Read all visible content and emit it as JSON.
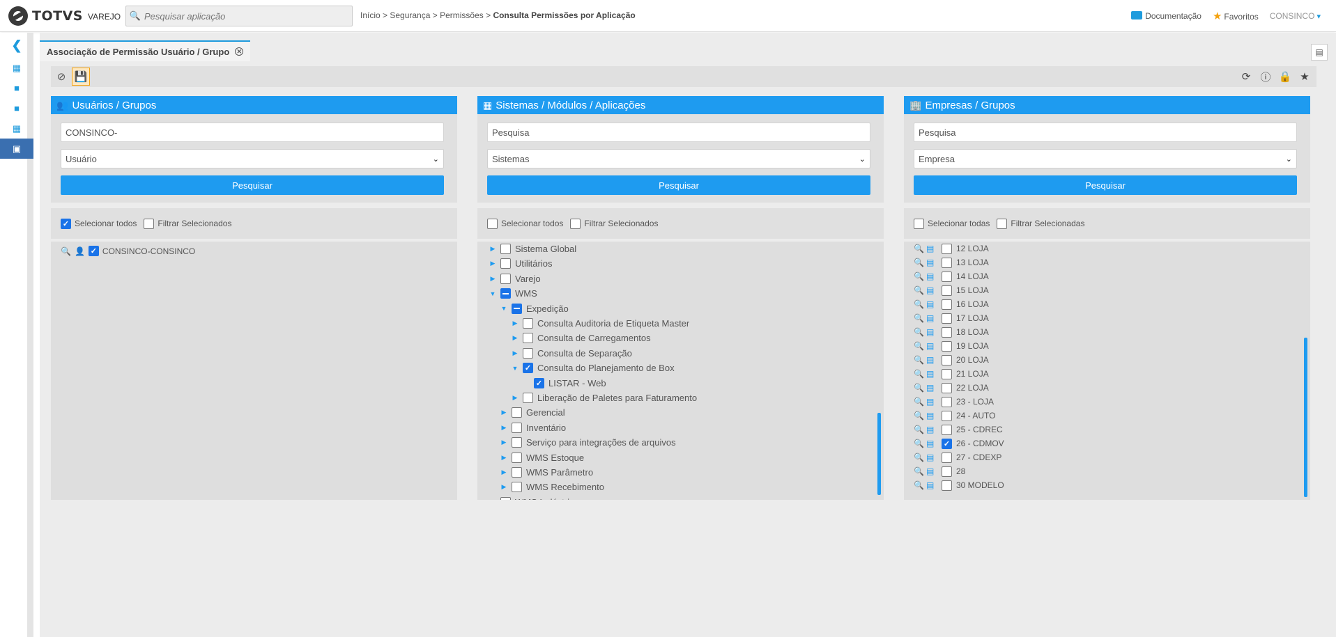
{
  "header": {
    "logo_main": "TOTVS",
    "logo_sub": "VAREJO",
    "search_placeholder": "Pesquisar aplicação",
    "breadcrumb_path": "Início > Segurança > Permissões > ",
    "breadcrumb_current": "Consulta Permissões por Aplicação",
    "documentation": "Documentação",
    "favorites": "Favoritos",
    "user": "CONSINCO"
  },
  "tab": {
    "title": "Associação de Permissão Usuário / Grupo"
  },
  "panels": {
    "users": {
      "title": "Usuários / Grupos",
      "input_value": "CONSINCO-",
      "select_value": "Usuário",
      "button": "Pesquisar",
      "select_all": "Selecionar todos",
      "filter_selected": "Filtrar Selecionados",
      "select_all_checked": true,
      "items": [
        {
          "label": "CONSINCO-CONSINCO",
          "checked": true
        }
      ]
    },
    "systems": {
      "title": "Sistemas / Módulos / Aplicações",
      "input_placeholder": "Pesquisa",
      "select_value": "Sistemas",
      "button": "Pesquisar",
      "select_all": "Selecionar todos",
      "filter_selected": "Filtrar Selecionados",
      "tree": [
        {
          "label": "Sistema Global",
          "level": 0,
          "arrow": "right",
          "state": "off"
        },
        {
          "label": "Utilitários",
          "level": 0,
          "arrow": "right",
          "state": "off"
        },
        {
          "label": "Varejo",
          "level": 0,
          "arrow": "right",
          "state": "off"
        },
        {
          "label": "WMS",
          "level": 0,
          "arrow": "down",
          "state": "part"
        },
        {
          "label": "Expedição",
          "level": 1,
          "arrow": "down",
          "state": "part"
        },
        {
          "label": "Consulta Auditoria de Etiqueta Master",
          "level": 2,
          "arrow": "right",
          "state": "off"
        },
        {
          "label": "Consulta de Carregamentos",
          "level": 2,
          "arrow": "right",
          "state": "off"
        },
        {
          "label": "Consulta de Separação",
          "level": 2,
          "arrow": "right",
          "state": "off"
        },
        {
          "label": "Consulta do Planejamento de Box",
          "level": 2,
          "arrow": "down",
          "state": "on"
        },
        {
          "label": "LISTAR - Web",
          "level": 3,
          "arrow": "none",
          "state": "on"
        },
        {
          "label": "Liberação de Paletes para Faturamento",
          "level": 2,
          "arrow": "right",
          "state": "off"
        },
        {
          "label": "Gerencial",
          "level": 1,
          "arrow": "right",
          "state": "off"
        },
        {
          "label": "Inventário",
          "level": 1,
          "arrow": "right",
          "state": "off"
        },
        {
          "label": "Serviço para integrações de arquivos",
          "level": 1,
          "arrow": "right",
          "state": "off"
        },
        {
          "label": "WMS Estoque",
          "level": 1,
          "arrow": "right",
          "state": "off"
        },
        {
          "label": "WMS Parâmetro",
          "level": 1,
          "arrow": "right",
          "state": "off"
        },
        {
          "label": "WMS Recebimento",
          "level": 1,
          "arrow": "right",
          "state": "off"
        },
        {
          "label": "WMS Indústria",
          "level": 0,
          "arrow": "right",
          "state": "off"
        }
      ]
    },
    "companies": {
      "title": "Empresas / Grupos",
      "input_placeholder": "Pesquisa",
      "select_value": "Empresa",
      "button": "Pesquisar",
      "select_all": "Selecionar todas",
      "filter_selected": "Filtrar Selecionadas",
      "items": [
        {
          "label": "12 LOJA",
          "checked": false
        },
        {
          "label": "13 LOJA",
          "checked": false
        },
        {
          "label": "14 LOJA",
          "checked": false
        },
        {
          "label": "15 LOJA",
          "checked": false
        },
        {
          "label": "16 LOJA",
          "checked": false
        },
        {
          "label": "17 LOJA",
          "checked": false
        },
        {
          "label": "18 LOJA",
          "checked": false
        },
        {
          "label": "19 LOJA",
          "checked": false
        },
        {
          "label": "20 LOJA",
          "checked": false
        },
        {
          "label": "21 LOJA",
          "checked": false
        },
        {
          "label": "22 LOJA",
          "checked": false
        },
        {
          "label": "23 - LOJA",
          "checked": false
        },
        {
          "label": "24 - AUTO",
          "checked": false
        },
        {
          "label": "25 - CDREC",
          "checked": false
        },
        {
          "label": "26 - CDMOV",
          "checked": true
        },
        {
          "label": "27 - CDEXP",
          "checked": false
        },
        {
          "label": "28",
          "checked": false
        },
        {
          "label": "30 MODELO",
          "checked": false
        }
      ]
    }
  },
  "colors": {
    "accent": "#1e9bf0",
    "nav_active": "#3a6fb0",
    "save_bg": "#fde8c2"
  }
}
